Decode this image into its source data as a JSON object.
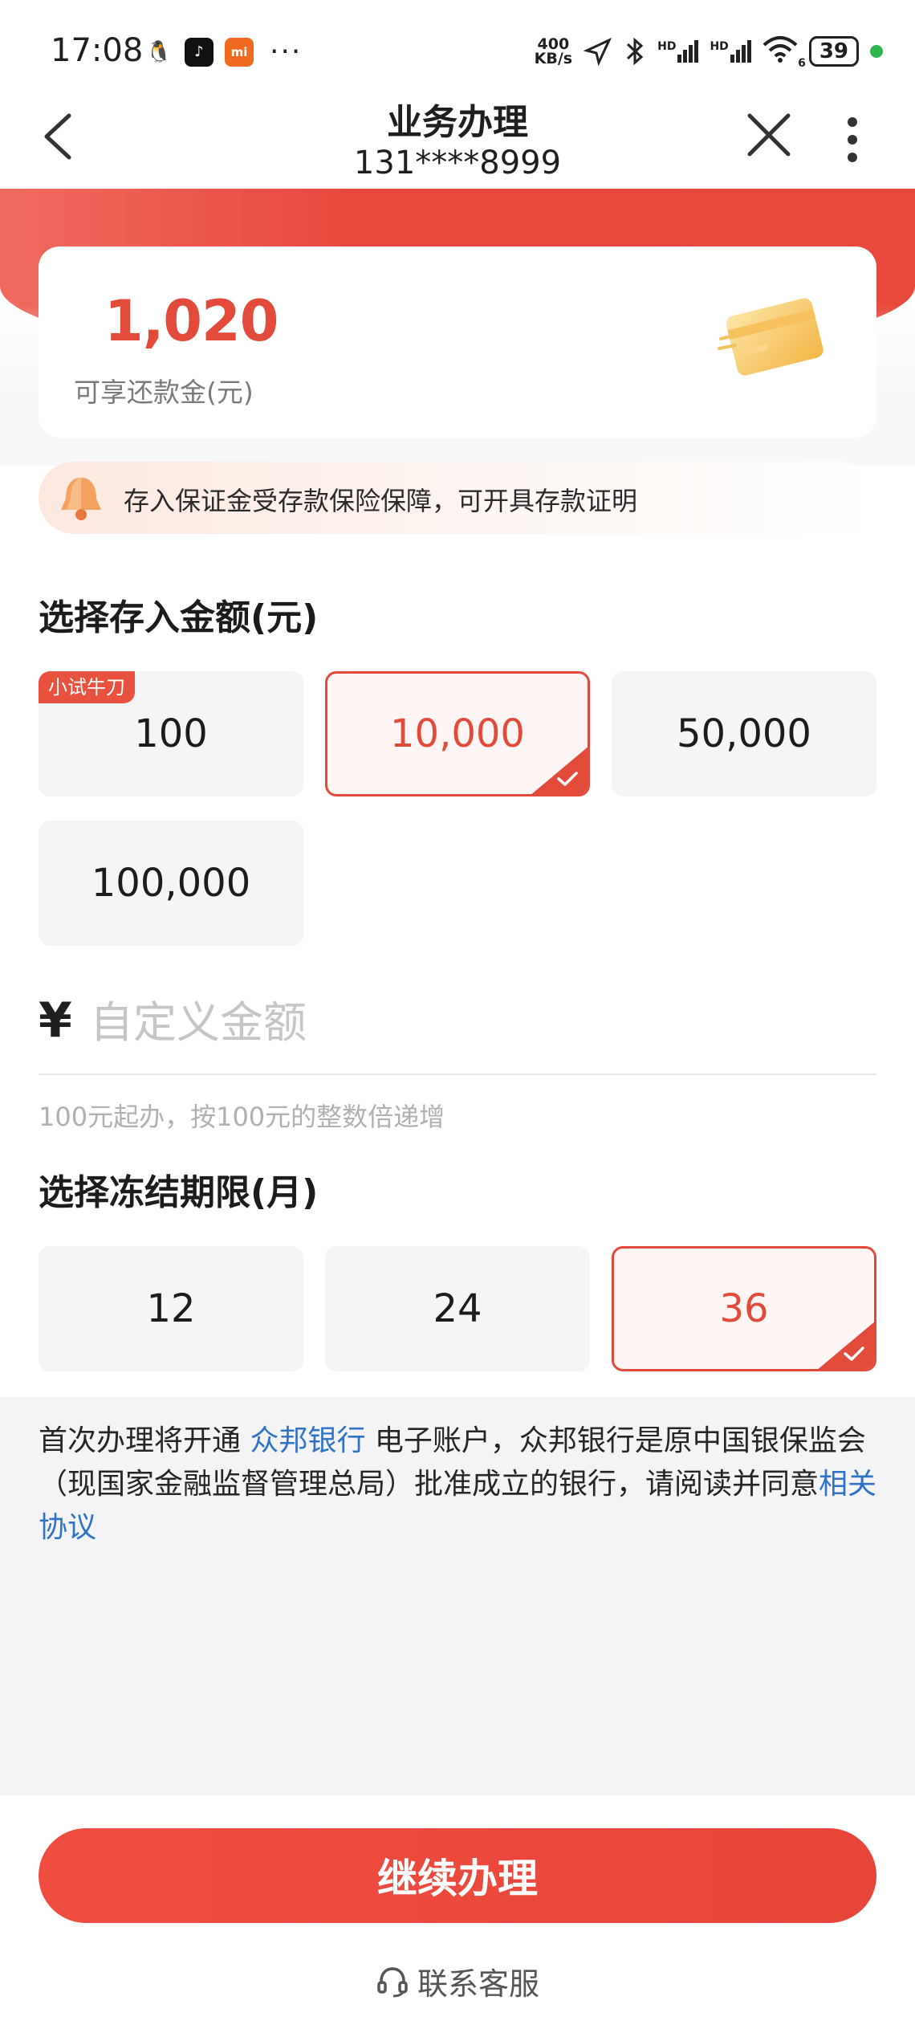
{
  "status_bar": {
    "time": "17:08",
    "net_speed_top": "400",
    "net_speed_bottom": "KB/s",
    "hd1": "HD",
    "hd2": "HD",
    "wifi_sub": "6",
    "battery": "39",
    "more": "···"
  },
  "nav": {
    "title": "业务办理",
    "subtitle": "131****8999"
  },
  "summary": {
    "amount": "1,020",
    "label": "可享还款金(元)"
  },
  "notice": {
    "text": "存入保证金受存款保险保障，可开具存款证明"
  },
  "deposit": {
    "title": "选择存入金额(元)",
    "tag": "小试牛刀",
    "options": [
      "100",
      "10,000",
      "50,000",
      "100,000"
    ],
    "selected_index": 1,
    "yen": "¥",
    "custom_placeholder": "自定义金额",
    "hint": "100元起办，按100元的整数倍递增"
  },
  "term": {
    "title": "选择冻结期限(月)",
    "options": [
      "12",
      "24",
      "36"
    ],
    "selected_index": 2
  },
  "agreement": {
    "prefix": "首次办理将开通 ",
    "bank_link": "众邦银行",
    "middle": " 电子账户，众邦银行是原中国银保监会（现国家金融监督管理总局）批准成立的银行，请阅读并同意",
    "protocol_link": "相关协议"
  },
  "actions": {
    "continue_label": "继续办理",
    "service_label": "联系客服"
  },
  "colors": {
    "accent": "#e24a3a",
    "link": "#2f73c7"
  },
  "icons": [
    "back-arrow-icon",
    "close-icon",
    "more-vertical-icon",
    "credit-card-icon",
    "bell-icon",
    "check-icon",
    "headset-icon"
  ]
}
